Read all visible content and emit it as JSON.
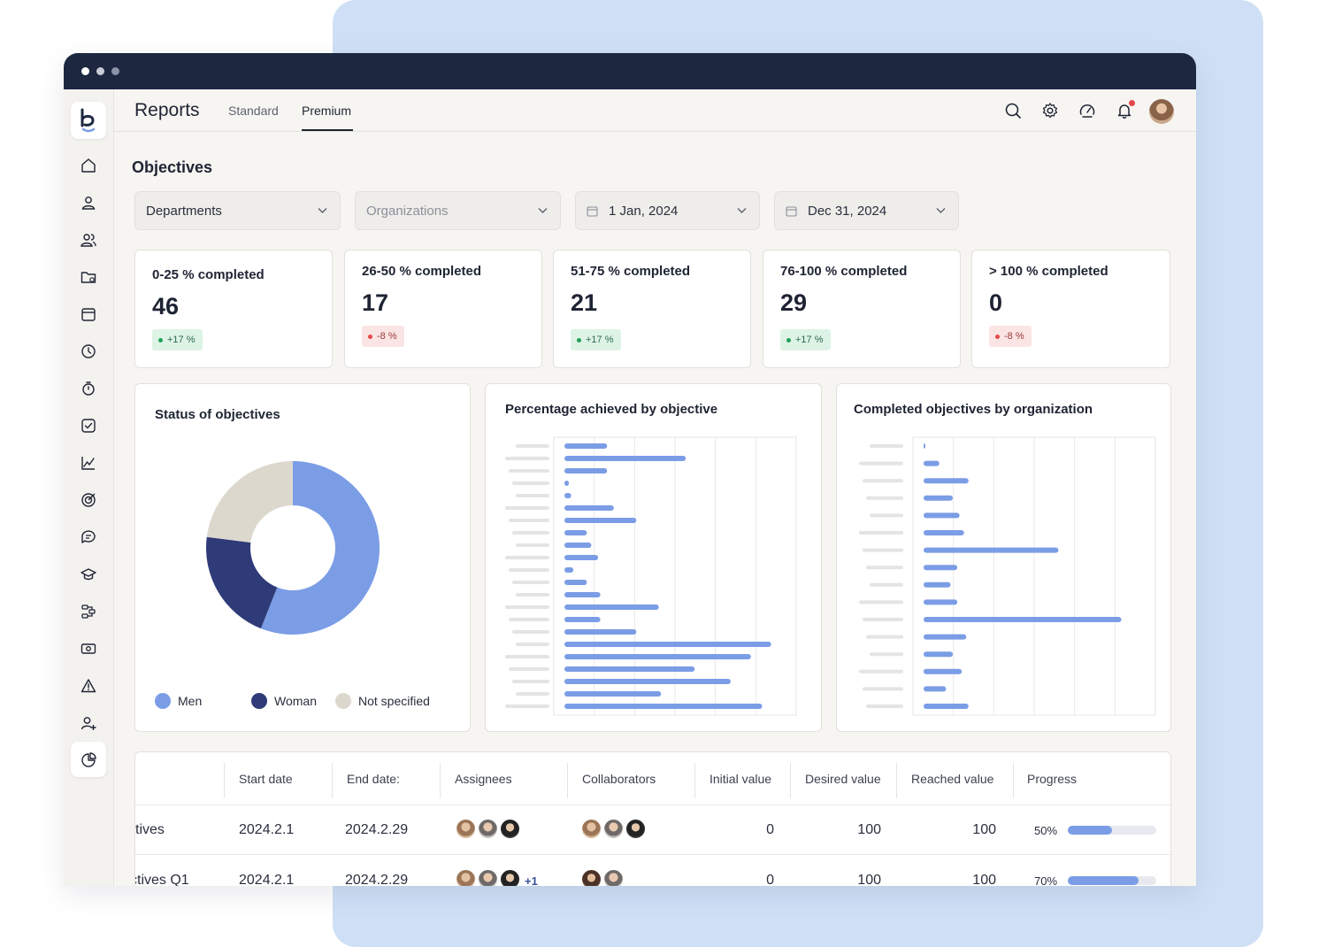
{
  "app": {
    "title": "Reports",
    "tabs": [
      {
        "label": "Standard",
        "active": false
      },
      {
        "label": "Premium",
        "active": true
      }
    ],
    "top_icons": [
      "search-icon",
      "gear-icon",
      "gauge-icon",
      "bell-icon"
    ],
    "notification_dot_color": "#e5484d"
  },
  "sidebar": {
    "logo": "b",
    "icons": [
      "home-icon",
      "user-icon",
      "users-icon",
      "folder-icon",
      "calendar-icon",
      "clock-icon",
      "stopwatch-icon",
      "checkbox-icon",
      "line-chart-icon",
      "target-icon",
      "chat-icon",
      "graduation-cap-icon",
      "workflow-icon",
      "money-icon",
      "warning-icon",
      "add-user-icon",
      "pie-chart-icon"
    ],
    "active": "pie-chart-icon"
  },
  "page": {
    "title": "Objectives",
    "filters": [
      {
        "label": "Departments",
        "placeholder": false,
        "icon": null
      },
      {
        "label": "Organizations",
        "placeholder": true,
        "icon": null
      },
      {
        "label": "1 Jan, 2024",
        "placeholder": false,
        "icon": "calendar-icon"
      },
      {
        "label": "Dec 31, 2024",
        "placeholder": false,
        "icon": "calendar-icon"
      }
    ],
    "kpis": [
      {
        "label": "0-25 % completed",
        "value": "46",
        "delta": "+17 %",
        "trend": "up"
      },
      {
        "label": "26-50 % completed",
        "value": "17",
        "delta": "-8 %",
        "trend": "down"
      },
      {
        "label": "51-75 % completed",
        "value": "21",
        "delta": "+17 %",
        "trend": "up"
      },
      {
        "label": "76-100 % completed",
        "value": "29",
        "delta": "+17 %",
        "trend": "up"
      },
      {
        "label": "> 100 % completed",
        "value": "0",
        "delta": "-8 %",
        "trend": "down"
      }
    ],
    "cards": {
      "status_title": "Status of objectives",
      "percentage_title": "Percentage achieved by objective",
      "completed_title": "Completed objectives by organization"
    }
  },
  "chart_data": [
    {
      "type": "pie",
      "title": "Status of objectives",
      "donut": true,
      "series": [
        {
          "name": "Men",
          "value": 56,
          "color": "#7b9de6"
        },
        {
          "name": "Woman",
          "value": 21,
          "color": "#2f3b78"
        },
        {
          "name": "Not specified",
          "value": 23,
          "color": "#ddd8ce"
        }
      ],
      "legend": "bottom"
    },
    {
      "type": "bar",
      "orientation": "horizontal",
      "title": "Percentage achieved by objective",
      "category_labels_visible": false,
      "xlim": [
        0,
        100
      ],
      "grid": true,
      "color": "#7b9de6",
      "values": [
        19,
        54,
        19,
        2,
        3,
        22,
        32,
        10,
        12,
        15,
        4,
        10,
        16,
        42,
        16,
        32,
        92,
        83,
        58,
        74,
        43,
        88
      ]
    },
    {
      "type": "bar",
      "orientation": "horizontal",
      "title": "Completed objectives by organization",
      "category_labels_visible": false,
      "xlim": [
        0,
        100
      ],
      "grid": true,
      "color": "#7b9de6",
      "values": [
        0.5,
        7,
        20,
        13,
        16,
        18,
        60,
        15,
        12,
        15,
        88,
        19,
        13,
        17,
        10,
        20
      ]
    }
  ],
  "table": {
    "headers": [
      "Start date",
      "End date:",
      "Assignees",
      "Collaborators",
      "Initial value",
      "Desired value",
      "Reached value",
      "Progress"
    ],
    "rows": [
      {
        "name": "tives",
        "start": "2024.2.1",
        "end": "2024.2.29",
        "assignees_extra": "",
        "initial": "0",
        "desired": "100",
        "reached": "100",
        "progress_label": "50%",
        "progress": 0.5
      },
      {
        "name": "ctives Q1",
        "start": "2024.2.1",
        "end": "2024.2.29",
        "assignees_extra": "+1",
        "initial": "0",
        "desired": "100",
        "reached": "100",
        "progress_label": "70%",
        "progress": 0.8
      }
    ]
  },
  "colors": {
    "accent": "#7b9de6",
    "dark_navy": "#1d2840",
    "background_panel": "#cfe0f6",
    "positive": "#20a35a",
    "negative": "#e5484d"
  }
}
